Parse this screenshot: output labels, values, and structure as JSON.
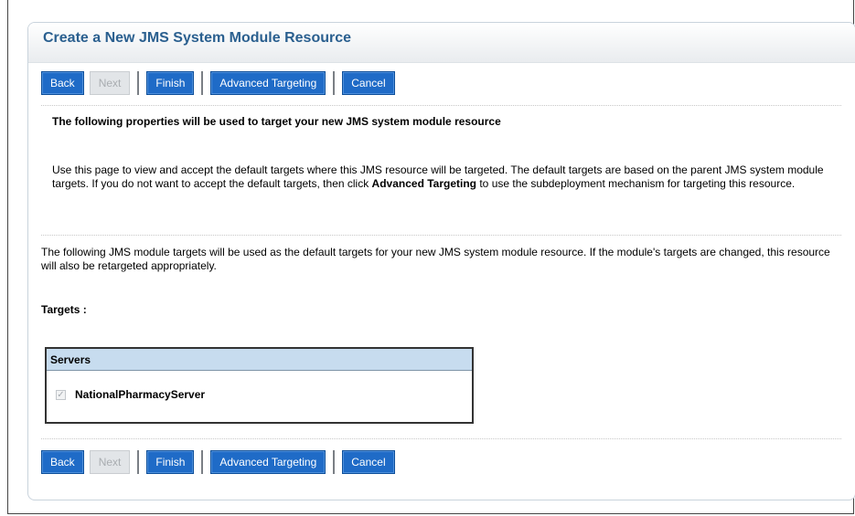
{
  "panel": {
    "title": "Create a New JMS System Module Resource"
  },
  "buttons": {
    "back": "Back",
    "next": "Next",
    "finish": "Finish",
    "advanced_targeting": "Advanced Targeting",
    "cancel": "Cancel"
  },
  "content": {
    "subtitle": "The following properties will be used to target your new JMS system module resource",
    "desc_part1": "Use this page to view and accept the default targets where this JMS resource will be targeted. The default targets are based on the parent JMS system module targets. If you do not want to accept the default targets, then click ",
    "desc_bold": "Advanced Targeting",
    "desc_part2": " to use the subdeployment mechanism for targeting this resource.",
    "info": "The following JMS module targets will be used as the default targets for your new JMS system module resource. If the module's targets are changed, this resource will also be retargeted appropriately.",
    "targets_label": "Targets :"
  },
  "table": {
    "header": "Servers",
    "rows": [
      {
        "name": "NationalPharmacyServer",
        "checked": true,
        "disabled": true
      }
    ]
  },
  "colors": {
    "accent": "#1f6bc7",
    "title": "#2a5f8f",
    "table_header": "#c7dcef"
  }
}
